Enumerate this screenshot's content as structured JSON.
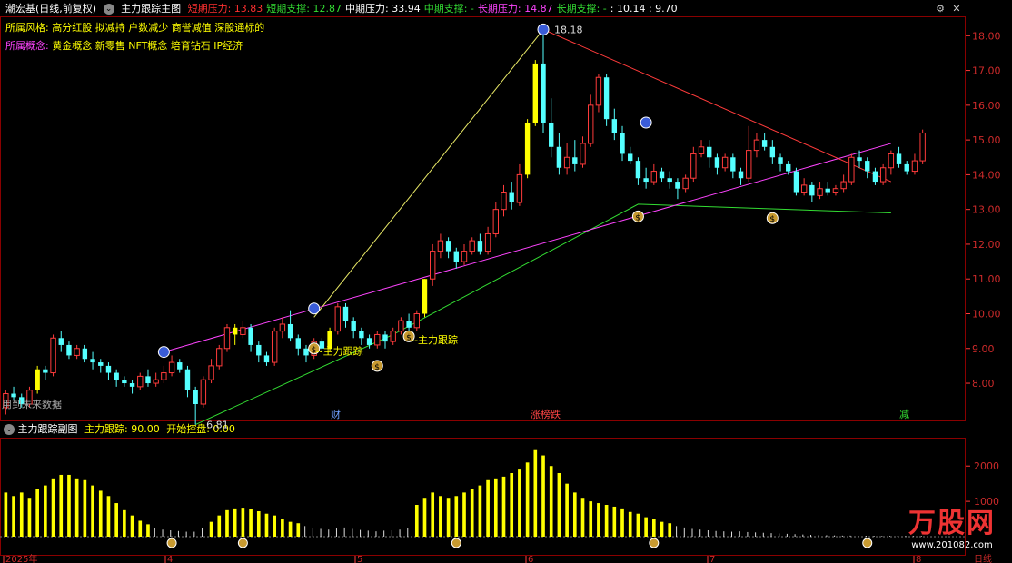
{
  "main_header": {
    "stock": "潮宏基(日线,前复权)",
    "indicator": "主力跟踪主图",
    "items": [
      {
        "label": "短期压力: ",
        "value": "13.83",
        "color": "#ff3030"
      },
      {
        "label": "短期支撑: ",
        "value": "12.87",
        "color": "#33dd33"
      },
      {
        "label": "中期压力: ",
        "value": "33.94",
        "color": "#ffffff"
      },
      {
        "label": "中期支撑: ",
        "value": "-",
        "color": "#33dd33"
      },
      {
        "label": "长期压力: ",
        "value": "14.87",
        "color": "#ff44ff"
      },
      {
        "label": "长期支撑: ",
        "value": "-",
        "color": "#33dd33"
      },
      {
        "label": "",
        "value": ": 10.14 : 9.70",
        "color": "#ffffff"
      }
    ]
  },
  "style_row": {
    "label": "所属风格:",
    "value": "高分红股 拟减持 户数减少 商誉减值 深股通标的"
  },
  "concept_row": {
    "label": "所属概念:",
    "value": "黄金概念 新零售 NFT概念 培育钻石 IP经济"
  },
  "annotations": {
    "high_price": "18.18",
    "low_price": "6.81",
    "tag_main_follow_1": "--主力跟踪",
    "tag_main_follow_2": "--主力跟踪",
    "future_data_note": "用到未来数据",
    "event_cai": "财",
    "event_limit": "涨榜跌",
    "event_reduce": "减"
  },
  "sub_header": {
    "indicator": "主力跟踪副图",
    "item1_label": "主力跟踪: ",
    "item1_value": "90.00",
    "item2_label": "开始控盘: ",
    "item2_value": "0.00"
  },
  "axes": {
    "main_ticks": [
      "18.00",
      "17.00",
      "16.00",
      "15.00",
      "14.00",
      "13.00",
      "12.00",
      "11.00",
      "10.00",
      "9.00",
      "8.00"
    ],
    "sub_ticks": [
      "2000",
      "1000"
    ],
    "date_ticks": [
      "2025年",
      "4",
      "5",
      "6",
      "7",
      "8"
    ],
    "period": "日线"
  },
  "watermark": {
    "text": "万股网",
    "url": "www.201082.com"
  },
  "colors": {
    "up": "#ff3b3b",
    "down": "#54ffff",
    "yellow": "#ffff00",
    "pink": "#ff44ff",
    "green": "#33dd33",
    "border": "#8a0000"
  },
  "chart_data": {
    "type": "candlestick",
    "ylim": [
      7.4,
      18.4
    ],
    "candles": [
      [
        7.3,
        7.7,
        7.1,
        7.8
      ],
      [
        7.7,
        7.6,
        7.5,
        7.9
      ],
      [
        7.6,
        7.4,
        7.3,
        7.7
      ],
      [
        7.4,
        7.8,
        7.3,
        7.9
      ],
      [
        7.8,
        8.4,
        7.7,
        8.5
      ],
      [
        8.4,
        8.3,
        8.1,
        8.5
      ],
      [
        8.3,
        9.3,
        8.2,
        9.4
      ],
      [
        9.3,
        9.1,
        8.9,
        9.5
      ],
      [
        9.1,
        8.8,
        8.7,
        9.2
      ],
      [
        8.8,
        9.0,
        8.7,
        9.1
      ],
      [
        9.0,
        8.7,
        8.6,
        9.1
      ],
      [
        8.7,
        8.6,
        8.4,
        8.9
      ],
      [
        8.6,
        8.5,
        8.3,
        8.7
      ],
      [
        8.5,
        8.3,
        8.1,
        8.6
      ],
      [
        8.3,
        8.1,
        7.9,
        8.4
      ],
      [
        8.1,
        8.0,
        7.9,
        8.2
      ],
      [
        8.0,
        7.9,
        7.7,
        8.1
      ],
      [
        7.9,
        8.2,
        7.8,
        8.3
      ],
      [
        8.2,
        8.0,
        7.9,
        8.4
      ],
      [
        8.0,
        8.1,
        7.9,
        8.3
      ],
      [
        8.1,
        8.3,
        8.0,
        8.5
      ],
      [
        8.3,
        8.6,
        8.2,
        8.8
      ],
      [
        8.6,
        8.4,
        8.3,
        8.7
      ],
      [
        8.4,
        7.8,
        7.6,
        8.5
      ],
      [
        7.8,
        7.4,
        6.81,
        7.9
      ],
      [
        7.4,
        8.1,
        7.3,
        8.2
      ],
      [
        8.1,
        8.5,
        8.0,
        8.7
      ],
      [
        8.5,
        9.0,
        8.4,
        9.1
      ],
      [
        9.0,
        9.6,
        8.9,
        9.7
      ],
      [
        9.6,
        9.4,
        9.1,
        9.7
      ],
      [
        9.4,
        9.6,
        9.3,
        9.8
      ],
      [
        9.6,
        9.1,
        8.9,
        9.7
      ],
      [
        9.1,
        8.8,
        8.6,
        9.2
      ],
      [
        8.8,
        8.6,
        8.5,
        8.9
      ],
      [
        8.6,
        9.5,
        8.5,
        9.6
      ],
      [
        9.5,
        9.7,
        9.3,
        9.9
      ],
      [
        9.7,
        9.3,
        9.2,
        10.1
      ],
      [
        9.3,
        9.0,
        8.8,
        9.4
      ],
      [
        9.0,
        8.8,
        8.6,
        9.1
      ],
      [
        8.8,
        9.2,
        8.7,
        9.3
      ],
      [
        9.2,
        9.0,
        8.9,
        9.3
      ],
      [
        9.0,
        9.5,
        8.9,
        9.6
      ],
      [
        9.5,
        10.2,
        9.4,
        10.3
      ],
      [
        10.2,
        9.8,
        9.6,
        10.3
      ],
      [
        9.8,
        9.5,
        9.3,
        9.9
      ],
      [
        9.5,
        9.3,
        9.1,
        9.6
      ],
      [
        9.3,
        9.1,
        9.0,
        9.4
      ],
      [
        9.1,
        9.4,
        9.0,
        9.5
      ],
      [
        9.4,
        9.2,
        9.0,
        9.5
      ],
      [
        9.2,
        9.5,
        9.1,
        9.6
      ],
      [
        9.5,
        9.8,
        9.4,
        9.9
      ],
      [
        9.8,
        9.6,
        9.4,
        10.0
      ],
      [
        9.6,
        10.0,
        9.5,
        10.1
      ],
      [
        10.0,
        11.0,
        9.9,
        11.0
      ],
      [
        11.0,
        11.8,
        10.8,
        12.0
      ],
      [
        11.8,
        12.1,
        11.6,
        12.3
      ],
      [
        12.1,
        11.8,
        11.6,
        12.2
      ],
      [
        11.8,
        11.5,
        11.3,
        11.9
      ],
      [
        11.5,
        11.8,
        11.4,
        12.0
      ],
      [
        11.8,
        12.1,
        11.7,
        12.2
      ],
      [
        12.1,
        11.8,
        11.7,
        12.3
      ],
      [
        11.8,
        12.3,
        11.7,
        12.5
      ],
      [
        12.3,
        13.0,
        12.2,
        13.2
      ],
      [
        13.0,
        13.5,
        12.8,
        13.7
      ],
      [
        13.5,
        13.2,
        13.0,
        13.8
      ],
      [
        13.2,
        14.0,
        13.1,
        14.3
      ],
      [
        14.0,
        15.5,
        13.9,
        15.6
      ],
      [
        15.5,
        17.2,
        15.4,
        17.3
      ],
      [
        17.2,
        15.5,
        15.2,
        18.18
      ],
      [
        15.5,
        14.8,
        14.5,
        16.2
      ],
      [
        14.8,
        14.2,
        14.0,
        15.2
      ],
      [
        14.2,
        14.5,
        14.0,
        14.9
      ],
      [
        14.5,
        14.3,
        14.1,
        15.0
      ],
      [
        14.3,
        14.9,
        14.2,
        15.1
      ],
      [
        14.9,
        16.0,
        14.8,
        16.3
      ],
      [
        16.0,
        16.8,
        15.8,
        16.9
      ],
      [
        16.8,
        15.6,
        15.4,
        16.9
      ],
      [
        15.6,
        15.2,
        15.0,
        15.9
      ],
      [
        15.2,
        14.6,
        14.4,
        15.4
      ],
      [
        14.6,
        14.4,
        14.3,
        14.8
      ],
      [
        14.4,
        13.9,
        13.7,
        14.5
      ],
      [
        13.9,
        13.8,
        13.6,
        14.2
      ],
      [
        13.8,
        14.1,
        13.7,
        14.3
      ],
      [
        14.1,
        13.9,
        13.8,
        14.2
      ],
      [
        13.9,
        13.8,
        13.6,
        14.1
      ],
      [
        13.8,
        13.6,
        13.3,
        13.9
      ],
      [
        13.6,
        13.9,
        13.5,
        14.0
      ],
      [
        13.9,
        14.6,
        13.8,
        14.8
      ],
      [
        14.6,
        14.8,
        14.5,
        15.0
      ],
      [
        14.8,
        14.5,
        14.2,
        15.0
      ],
      [
        14.5,
        14.2,
        14.0,
        14.6
      ],
      [
        14.2,
        14.5,
        14.1,
        14.6
      ],
      [
        14.5,
        14.1,
        13.9,
        14.6
      ],
      [
        14.1,
        13.9,
        13.7,
        14.2
      ],
      [
        13.9,
        14.7,
        13.8,
        15.4
      ],
      [
        14.7,
        15.0,
        14.5,
        15.2
      ],
      [
        15.0,
        14.8,
        14.7,
        15.2
      ],
      [
        14.8,
        14.5,
        14.3,
        15.0
      ],
      [
        14.5,
        14.3,
        14.1,
        14.6
      ],
      [
        14.3,
        14.1,
        14.0,
        14.4
      ],
      [
        14.1,
        13.5,
        13.4,
        14.2
      ],
      [
        13.5,
        13.7,
        13.4,
        13.9
      ],
      [
        13.7,
        13.4,
        13.2,
        13.8
      ],
      [
        13.4,
        13.6,
        13.3,
        13.8
      ],
      [
        13.6,
        13.5,
        13.4,
        13.8
      ],
      [
        13.5,
        13.6,
        13.4,
        13.7
      ],
      [
        13.6,
        13.8,
        13.5,
        14.0
      ],
      [
        13.8,
        14.5,
        13.7,
        14.6
      ],
      [
        14.5,
        14.4,
        14.2,
        14.7
      ],
      [
        14.4,
        14.1,
        13.9,
        14.5
      ],
      [
        14.1,
        13.8,
        13.7,
        14.2
      ],
      [
        13.8,
        14.2,
        13.7,
        14.3
      ],
      [
        14.2,
        14.6,
        14.0,
        14.7
      ],
      [
        14.6,
        14.3,
        14.2,
        14.8
      ],
      [
        14.3,
        14.1,
        14.0,
        14.4
      ],
      [
        14.1,
        14.4,
        14.0,
        14.6
      ],
      [
        14.4,
        15.2,
        14.3,
        15.3
      ]
    ],
    "yellow_candles": [
      4,
      29,
      41,
      53,
      66,
      67
    ],
    "sub_values": [
      1250,
      1150,
      1250,
      1100,
      1350,
      1450,
      1650,
      1750,
      1750,
      1650,
      1600,
      1450,
      1300,
      1150,
      950,
      750,
      600,
      450,
      350,
      250,
      200,
      180,
      160,
      140,
      140,
      250,
      420,
      600,
      750,
      800,
      820,
      780,
      720,
      650,
      600,
      500,
      420,
      380,
      300,
      250,
      220,
      200,
      230,
      260,
      220,
      190,
      170,
      150,
      170,
      180,
      200,
      250,
      900,
      1100,
      1250,
      1150,
      1100,
      1150,
      1250,
      1350,
      1450,
      1600,
      1650,
      1700,
      1800,
      1900,
      2100,
      2450,
      2300,
      2000,
      1800,
      1500,
      1250,
      1100,
      1000,
      950,
      900,
      850,
      800,
      700,
      650,
      550,
      500,
      420,
      380,
      300,
      260,
      220,
      200,
      180,
      160,
      150,
      140,
      150,
      130,
      120,
      110,
      100,
      90,
      80,
      70,
      60,
      50,
      45,
      40,
      35,
      30,
      30,
      25,
      25,
      25,
      20,
      20,
      20,
      20,
      20,
      20,
      20
    ],
    "sub_ylim": [
      0,
      2700
    ]
  }
}
